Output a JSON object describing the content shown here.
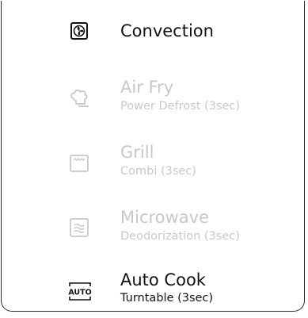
{
  "menu": {
    "items": [
      {
        "icon": "convection-icon",
        "label": "Convection",
        "sublabel": "",
        "enabled": true
      },
      {
        "icon": "air-fry-icon",
        "label": "Air Fry",
        "sublabel": "Power Defrost (3sec)",
        "enabled": false
      },
      {
        "icon": "grill-icon",
        "label": "Grill",
        "sublabel": "Combi (3sec)",
        "enabled": false
      },
      {
        "icon": "microwave-icon",
        "label": "Microwave",
        "sublabel": "Deodorization (3sec)",
        "enabled": false
      },
      {
        "icon": "auto-cook-icon",
        "label": "Auto Cook",
        "sublabel": "Turntable (3sec)",
        "enabled": true
      }
    ],
    "auto_icon_text": "AUTO"
  },
  "colors": {
    "active_text": "#111111",
    "disabled_text": "#c8c8c8",
    "border": "#2b2b2b",
    "background": "#ffffff"
  }
}
